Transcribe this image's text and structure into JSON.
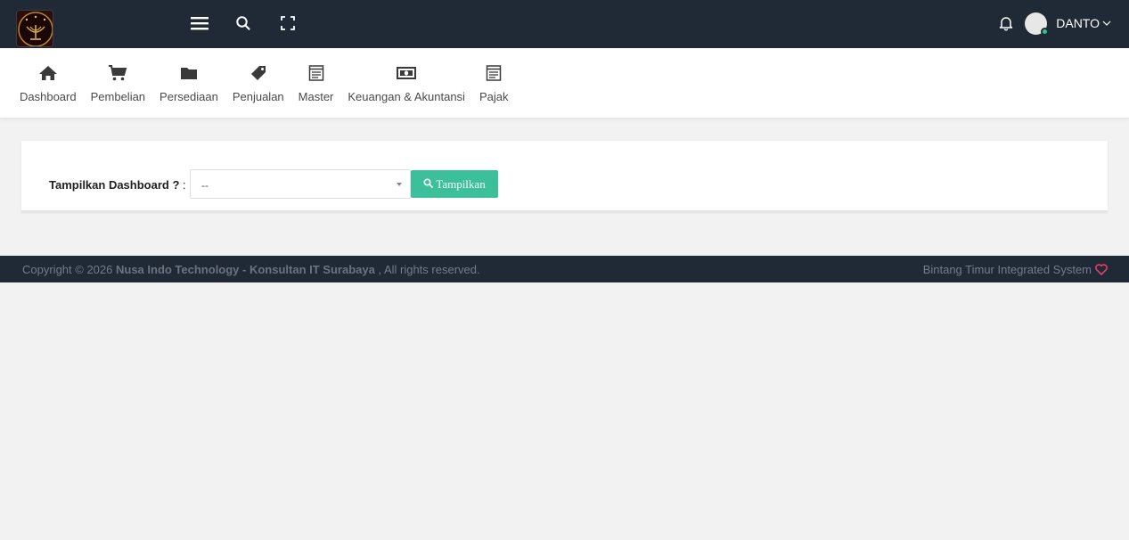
{
  "topbar": {
    "username": "DANTO",
    "icons": [
      "logo",
      "menu-icon",
      "search-icon",
      "fullscreen-icon",
      "bell-icon",
      "avatar",
      "chevron-down-icon"
    ]
  },
  "menu": {
    "items": [
      {
        "label": "Dashboard",
        "icon": "home-icon"
      },
      {
        "label": "Pembelian",
        "icon": "cart-icon"
      },
      {
        "label": "Persediaan",
        "icon": "folder-icon"
      },
      {
        "label": "Penjualan",
        "icon": "tag-icon"
      },
      {
        "label": "Master",
        "icon": "list-icon"
      },
      {
        "label": "Keuangan & Akuntansi",
        "icon": "money-icon"
      },
      {
        "label": "Pajak",
        "icon": "list-icon"
      }
    ]
  },
  "dashboard_form": {
    "label": "Tampilkan Dashboard ?",
    "colon": " :",
    "select_value": "--",
    "button_label": "Tampilkan"
  },
  "footer": {
    "copyright_prefix": "Copyright © 2026 ",
    "company": "Nusa Indo Technology - Konsultan IT Surabaya",
    "rights": " , All rights reserved.",
    "system_name": "Bintang Timur Integrated System"
  },
  "colors": {
    "topbar_bg": "#1f2a36",
    "accent_button": "#3cbf9b",
    "heart": "#e0406a",
    "online_status": "#35c28a"
  }
}
